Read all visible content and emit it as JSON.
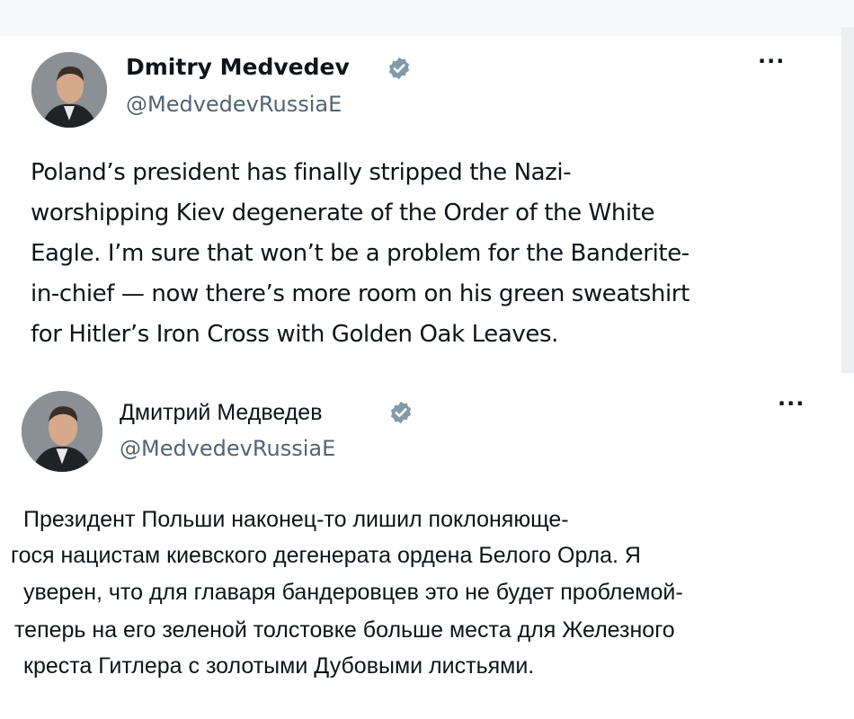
{
  "tweets": [
    {
      "author_name": "Dmitry Medvedev",
      "author_handle": "@MedvedevRussiaE",
      "verified": true,
      "more_label": "···",
      "text": "Poland’s president has finally stripped the Nazi-\nworshipping Kiev degenerate of the Order of the White\nEagle. I’m sure that won’t be a problem for the Banderite-\nin-chief — now there’s more room on his green sweatshirt\nfor Hitler’s Iron Cross with Golden Oak Leaves."
    },
    {
      "author_name": "Дмитрий Медведев",
      "author_handle": "@MedvedevRussiaE",
      "verified": true,
      "more_label": "···",
      "text_lines": [
        "Президент Польши наконец-то лишил поклоняюще-",
        "гося нацистам киевского дегенерата ордена Белого Орла. Я",
        "уверен, что для главаря бандеровцев это не будет проблемой-",
        "теперь на его зеленой толстовке больше места для Железного",
        "креста Гитлера с золотыми Дубовыми листьями."
      ]
    }
  ],
  "colors": {
    "verified_badge": "#829aab",
    "handle": "#536471",
    "text": "#0f1419"
  }
}
